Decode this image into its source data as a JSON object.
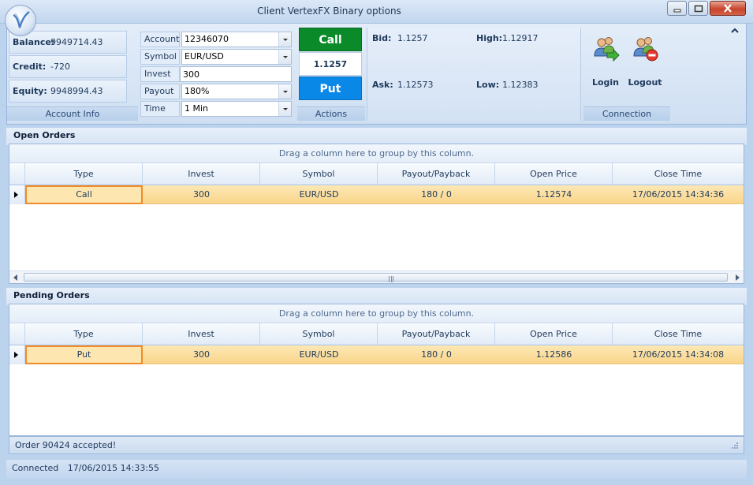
{
  "window": {
    "title": "Client VertexFX Binary options"
  },
  "account_info": {
    "caption": "Account Info",
    "rows": [
      {
        "label": "Balance:",
        "value": "9949714.43"
      },
      {
        "label": "Credit:",
        "value": "-720"
      },
      {
        "label": "Equity:",
        "value": "9948994.43"
      }
    ]
  },
  "order_form": {
    "fields": [
      {
        "label": "Account",
        "value": "12346070",
        "type": "select"
      },
      {
        "label": "Symbol",
        "value": "EUR/USD",
        "type": "select"
      },
      {
        "label": "Invest",
        "value": "300",
        "type": "text"
      },
      {
        "label": "Payout",
        "value": "180%",
        "type": "select"
      },
      {
        "label": "Time",
        "value": "1 Min",
        "type": "select"
      }
    ]
  },
  "actions": {
    "caption": "Actions",
    "call_label": "Call",
    "price": "1.1257",
    "put_label": "Put",
    "call_color": "#0b8a2a",
    "put_color": "#0a88e8"
  },
  "quotes": {
    "bid_label": "Bid:",
    "bid_value": "1.1257",
    "high_label": "High:",
    "high_value": "1.12917",
    "ask_label": "Ask:",
    "ask_value": "1.12573",
    "low_label": "Low:",
    "low_value": "1.12383"
  },
  "connection": {
    "caption": "Connection",
    "login_label": "Login",
    "logout_label": "Logout"
  },
  "open_orders": {
    "title": "Open Orders",
    "group_hint": "Drag a column here to group by this column.",
    "columns": [
      "Type",
      "Invest",
      "Symbol",
      "Payout/Payback",
      "Open Price",
      "Close Time"
    ],
    "rows": [
      {
        "type": "Call",
        "invest": "300",
        "symbol": "EUR/USD",
        "payout": "180 / 0",
        "open_price": "1.12574",
        "close_time": "17/06/2015 14:34:36"
      }
    ]
  },
  "pending_orders": {
    "title": "Pending Orders",
    "group_hint": "Drag a column here to group by this column.",
    "columns": [
      "Type",
      "Invest",
      "Symbol",
      "Payout/Payback",
      "Open Price",
      "Close Time"
    ],
    "rows": [
      {
        "type": "Put",
        "invest": "300",
        "symbol": "EUR/USD",
        "payout": "180 / 0",
        "open_price": "1.12586",
        "close_time": "17/06/2015 14:34:08"
      }
    ]
  },
  "status": {
    "message": "Order 90424 accepted!",
    "connection_text": "Connected",
    "connection_time": "17/06/2015 14:33:55"
  }
}
